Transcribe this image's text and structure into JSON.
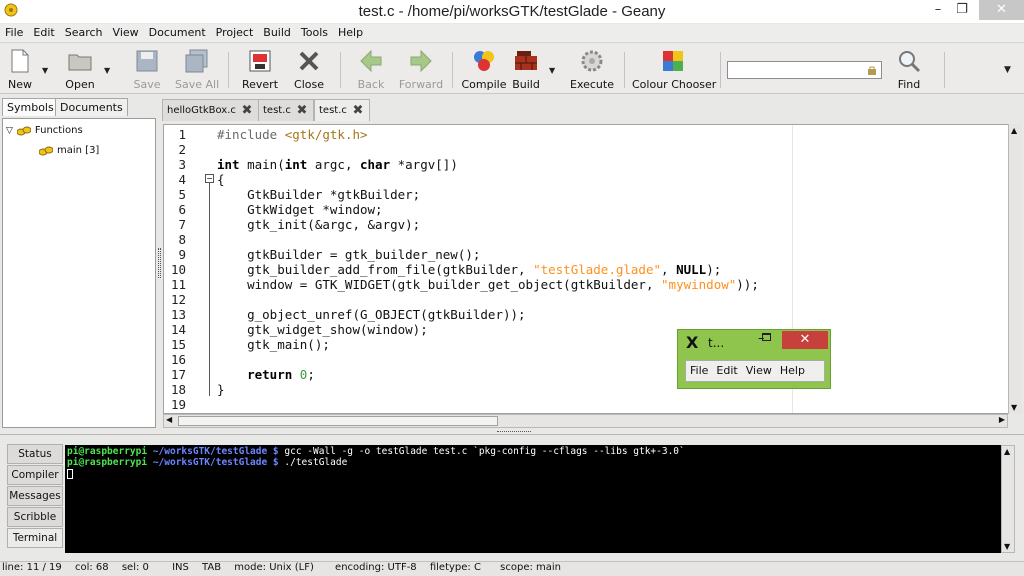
{
  "window": {
    "title": "test.c - /home/pi/worksGTK/testGlade - Geany",
    "minimize": "–",
    "maximize": "❐",
    "close": "✕"
  },
  "menu": [
    "File",
    "Edit",
    "Search",
    "View",
    "Document",
    "Project",
    "Build",
    "Tools",
    "Help"
  ],
  "toolbar": {
    "new": "New",
    "open": "Open",
    "save": "Save",
    "save_all": "Save All",
    "revert": "Revert",
    "close": "Close",
    "back": "Back",
    "forward": "Forward",
    "compile": "Compile",
    "build": "Build",
    "execute": "Execute",
    "colour_chooser": "Colour Chooser",
    "find": "Find"
  },
  "sidebar": {
    "tabs": [
      "Symbols",
      "Documents"
    ],
    "tree": {
      "group": "Functions",
      "item": "main [3]"
    }
  },
  "editor_tabs": [
    "helloGtkBox.c",
    "test.c",
    "test.c"
  ],
  "code": [
    "#include <gtk/gtk.h>",
    "",
    "int main(int argc, char *argv[])",
    "{",
    "    GtkBuilder *gtkBuilder;",
    "    GtkWidget *window;",
    "    gtk_init(&argc, &argv);",
    "",
    "    gtkBuilder = gtk_builder_new();",
    "    gtk_builder_add_from_file(gtkBuilder, \"testGlade.glade\", NULL);",
    "    window = GTK_WIDGET(gtk_builder_get_object(gtkBuilder, \"mywindow\"));",
    "",
    "    g_object_unref(G_OBJECT(gtkBuilder));",
    "    gtk_widget_show(window);",
    "    gtk_main();",
    "",
    "    return 0;",
    "}",
    ""
  ],
  "line_numbers": [
    "1",
    "2",
    "3",
    "4",
    "5",
    "6",
    "7",
    "8",
    "9",
    "10",
    "11",
    "12",
    "13",
    "14",
    "15",
    "16",
    "17",
    "18",
    "19"
  ],
  "popup": {
    "title": "t...",
    "menu": [
      "File",
      "Edit",
      "View",
      "Help"
    ]
  },
  "bottom_tabs": [
    "Status",
    "Compiler",
    "Messages",
    "Scribble",
    "Terminal"
  ],
  "terminal": {
    "lines": [
      {
        "user": "pi@raspberrypi",
        "path": "~/worksGTK/testGlade $",
        "cmd": " gcc -Wall -g -o testGlade test.c `pkg-config --cflags --libs gtk+-3.0`"
      },
      {
        "user": "pi@raspberrypi",
        "path": "~/worksGTK/testGlade $",
        "cmd": " ./testGlade"
      }
    ]
  },
  "status": {
    "line": "line: 11 / 19",
    "col": "col: 68",
    "sel": "sel: 0",
    "ins": "INS",
    "tab": "TAB",
    "mode": "mode: Unix (LF)",
    "encoding": "encoding: UTF-8",
    "filetype": "filetype: C",
    "scope": "scope: main"
  }
}
